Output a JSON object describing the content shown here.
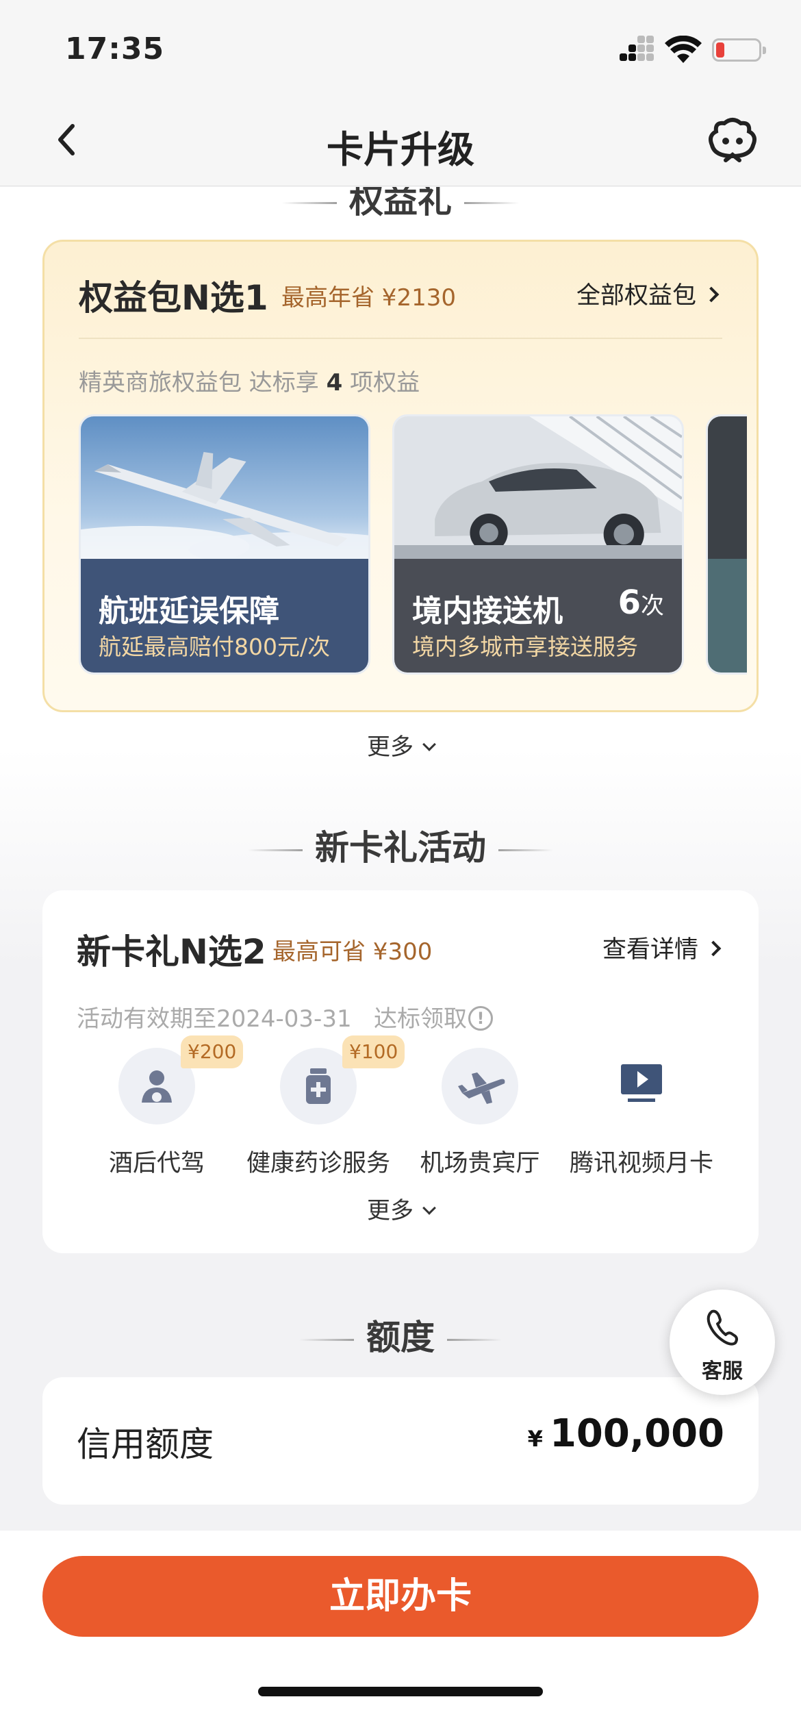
{
  "status_bar": {
    "time": "17:35"
  },
  "nav": {
    "title": "卡片升级"
  },
  "benefits": {
    "section_title": "权益礼",
    "title": "权益包N选1",
    "save_text": "最高年省 ¥2130",
    "all_link": "全部权益包",
    "subtitle_prefix": "精英商旅权益包   达标享",
    "subtitle_count": "4",
    "subtitle_suffix": "项权益",
    "items": [
      {
        "name": "航班延误保障",
        "desc": "航延最高赔付800元/次"
      },
      {
        "name": "境内接送机",
        "count": "6",
        "count_unit": "次",
        "desc": "境内多城市享接送服务"
      }
    ],
    "more": "更多"
  },
  "new_card": {
    "section_title": "新卡礼活动",
    "title": "新卡礼N选2",
    "save_text": "最高可省 ¥300",
    "detail_link": "查看详情",
    "validity": "活动有效期至2024-03-31",
    "reach_text": "达标领取",
    "gifts": [
      {
        "label": "酒后代驾",
        "tag": "¥200",
        "icon": "driver-icon"
      },
      {
        "label": "健康药诊服务",
        "tag": "¥100",
        "icon": "medicine-icon"
      },
      {
        "label": "机场贵宾厅",
        "icon": "airplane-icon"
      },
      {
        "label": "腾讯视频月卡",
        "icon": "video-icon"
      }
    ],
    "more": "更多"
  },
  "quota": {
    "section_title": "额度",
    "label": "信用额度",
    "currency": "¥",
    "value": "100,000"
  },
  "service": {
    "label": "客服"
  },
  "cta": {
    "label": "立即办卡"
  },
  "colors": {
    "accent": "#ea5a2c",
    "gold_text": "#a5652c",
    "tile_blue": "#3f5478",
    "tile_gray": "#4a4d55"
  }
}
